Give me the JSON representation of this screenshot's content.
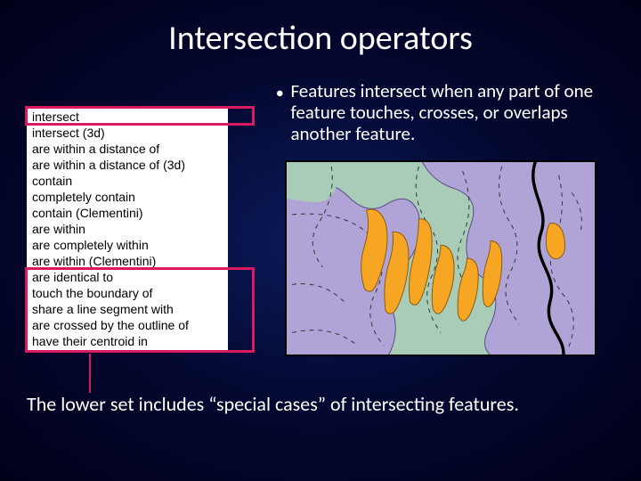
{
  "title": "Intersection operators",
  "bullet": "Features intersect when any part of one feature touches, crosses, or overlaps another feature.",
  "operators": {
    "items": [
      "intersect",
      "intersect (3d)",
      "are within a distance of",
      "are within a distance of (3d)",
      "contain",
      "completely contain",
      "contain (Clementini)",
      "are within",
      "are completely within",
      "are within (Clementini)",
      "are identical to",
      "touch the boundary of",
      "share a line segment with",
      "are crossed by the outline of",
      "have their centroid in"
    ]
  },
  "footer": "The lower set includes “special cases” of intersecting features.",
  "colors": {
    "highlight": "#d81b60",
    "map_bg": "#a8ccb8",
    "map_region": "#b0a3d6",
    "map_feature": "#f6a623"
  }
}
